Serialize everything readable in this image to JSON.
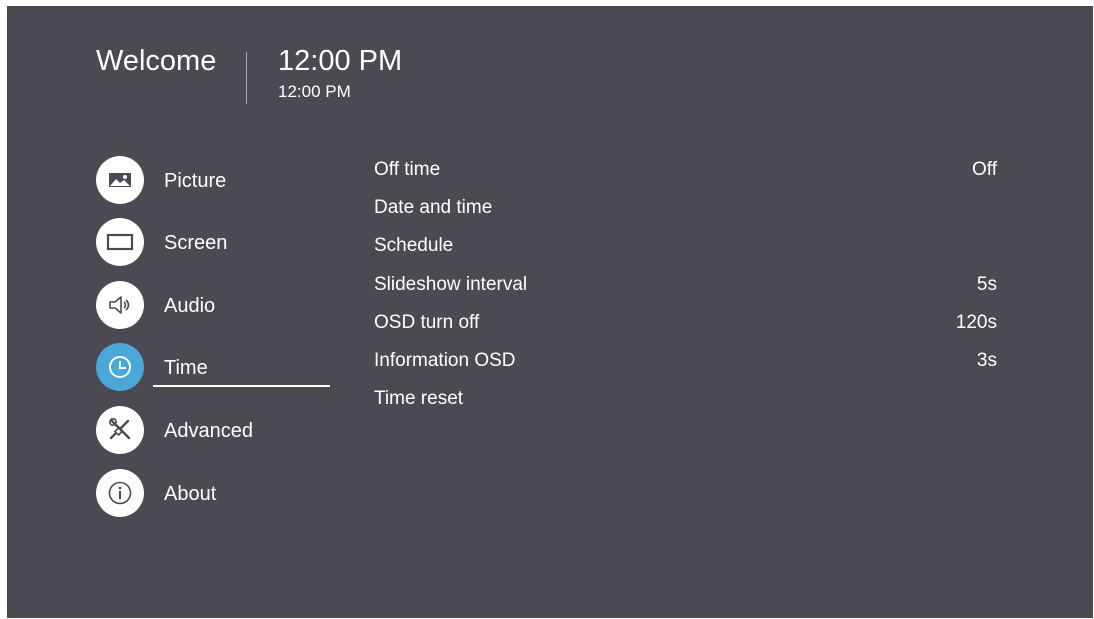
{
  "header": {
    "welcome": "Welcome",
    "clock_main": "12:00 PM",
    "clock_sub": "12:00 PM"
  },
  "sidebar": {
    "items": [
      {
        "label": "Picture",
        "icon": "picture-icon",
        "active": false
      },
      {
        "label": "Screen",
        "icon": "screen-icon",
        "active": false
      },
      {
        "label": "Audio",
        "icon": "speaker-icon",
        "active": false
      },
      {
        "label": "Time",
        "icon": "clock-icon",
        "active": true
      },
      {
        "label": "Advanced",
        "icon": "tools-icon",
        "active": false
      },
      {
        "label": "About",
        "icon": "info-icon",
        "active": false
      }
    ]
  },
  "settings": {
    "items": [
      {
        "label": "Off time",
        "value": "Off"
      },
      {
        "label": "Date and time",
        "value": ""
      },
      {
        "label": "Schedule",
        "value": ""
      },
      {
        "label": "Slideshow interval",
        "value": "5s"
      },
      {
        "label": "OSD turn off",
        "value": "120s"
      },
      {
        "label": "Information OSD",
        "value": "3s"
      },
      {
        "label": "Time reset",
        "value": ""
      }
    ]
  },
  "colors": {
    "background": "#4b4a53",
    "accent": "#4aa7d8",
    "text": "#ffffff"
  }
}
